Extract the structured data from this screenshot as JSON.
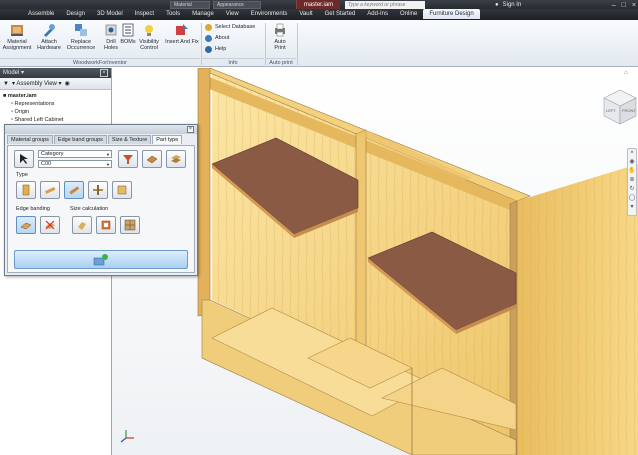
{
  "app": {
    "document_name": "master.iam",
    "search_placeholder": "Type a keyword or phrase",
    "sign_in": "Sign In",
    "quick_access": [
      "Material",
      "Appearance"
    ]
  },
  "tabs": [
    "Assemble",
    "Design",
    "3D Model",
    "Inspect",
    "Tools",
    "Manage",
    "View",
    "Environments",
    "Vault",
    "Get Started",
    "Add-Ins",
    "Online",
    "Furniture Design"
  ],
  "active_tab": "Furniture Design",
  "ribbon": {
    "buttons": [
      {
        "label1": "Material",
        "label2": "Assignment"
      },
      {
        "label1": "Attach",
        "label2": "Hardware"
      },
      {
        "label1": "Replace",
        "label2": "Occurrence"
      },
      {
        "label1": "Drill",
        "label2": "Holes"
      },
      {
        "label1": "BOMs",
        "label2": ""
      },
      {
        "label1": "Visibility",
        "label2": "Control"
      },
      {
        "label1": "Insert And Fix",
        "label2": ""
      }
    ],
    "group_woodwork": "WoodworkForInventor",
    "info_items": [
      "Select Database",
      "About",
      "Help"
    ],
    "group_info": "Info",
    "autoprint": {
      "label1": "Auto",
      "label2": "Print"
    },
    "group_autoprint": "Auto print"
  },
  "browser": {
    "title": "Model",
    "view": "Assembly View",
    "tree": [
      "master.iam",
      "Representations",
      "Origin",
      "Shared Left Cabinet"
    ]
  },
  "dialog": {
    "tabs": [
      "Material groups",
      "Edge band groups",
      "Size & Texture",
      "Part type"
    ],
    "active_tab": "Part type",
    "category_value": "Category",
    "code_value": "C00",
    "section_type": "Type",
    "section_edge": "Edge banding",
    "section_size": "Size calculation"
  },
  "viewcube": {
    "left": "LEFT",
    "front": "FRONT"
  },
  "colors": {
    "wood_light": "#f7d888",
    "wood_mid": "#eec66b",
    "wood_dark": "#d8a94e",
    "shelf": "#8a5a45",
    "ribbon_bg": "#eaeff5",
    "accent_tab": "#c6d9ee"
  }
}
